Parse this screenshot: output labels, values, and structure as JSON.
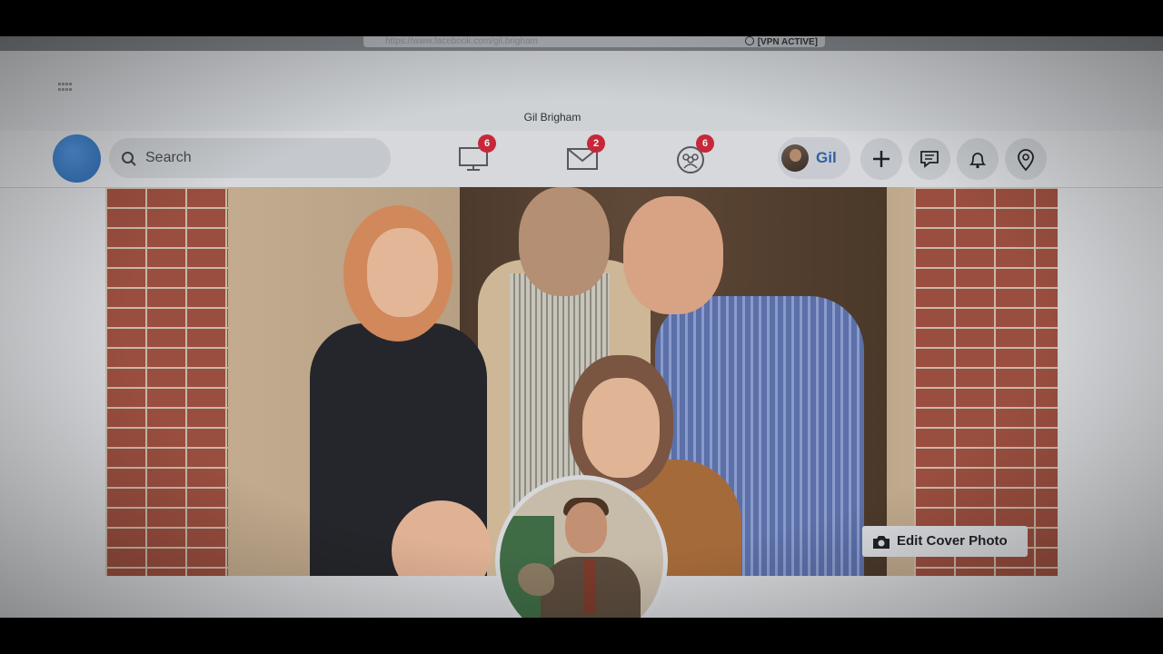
{
  "browser": {
    "url": "https://www.facebook.com/gil.brigham",
    "vpn_status": "[VPN ACTIVE]"
  },
  "window": {
    "title": "Gil Brigham"
  },
  "nav": {
    "search_placeholder": "Search",
    "badges": {
      "watch": "6",
      "messages": "2",
      "groups": "6"
    },
    "profile_name": "Gil"
  },
  "cover": {
    "edit_label": "Edit Cover Photo"
  },
  "colors": {
    "brand": "#3b74be",
    "badge": "#c6283a",
    "profile_name": "#2f62a0"
  }
}
